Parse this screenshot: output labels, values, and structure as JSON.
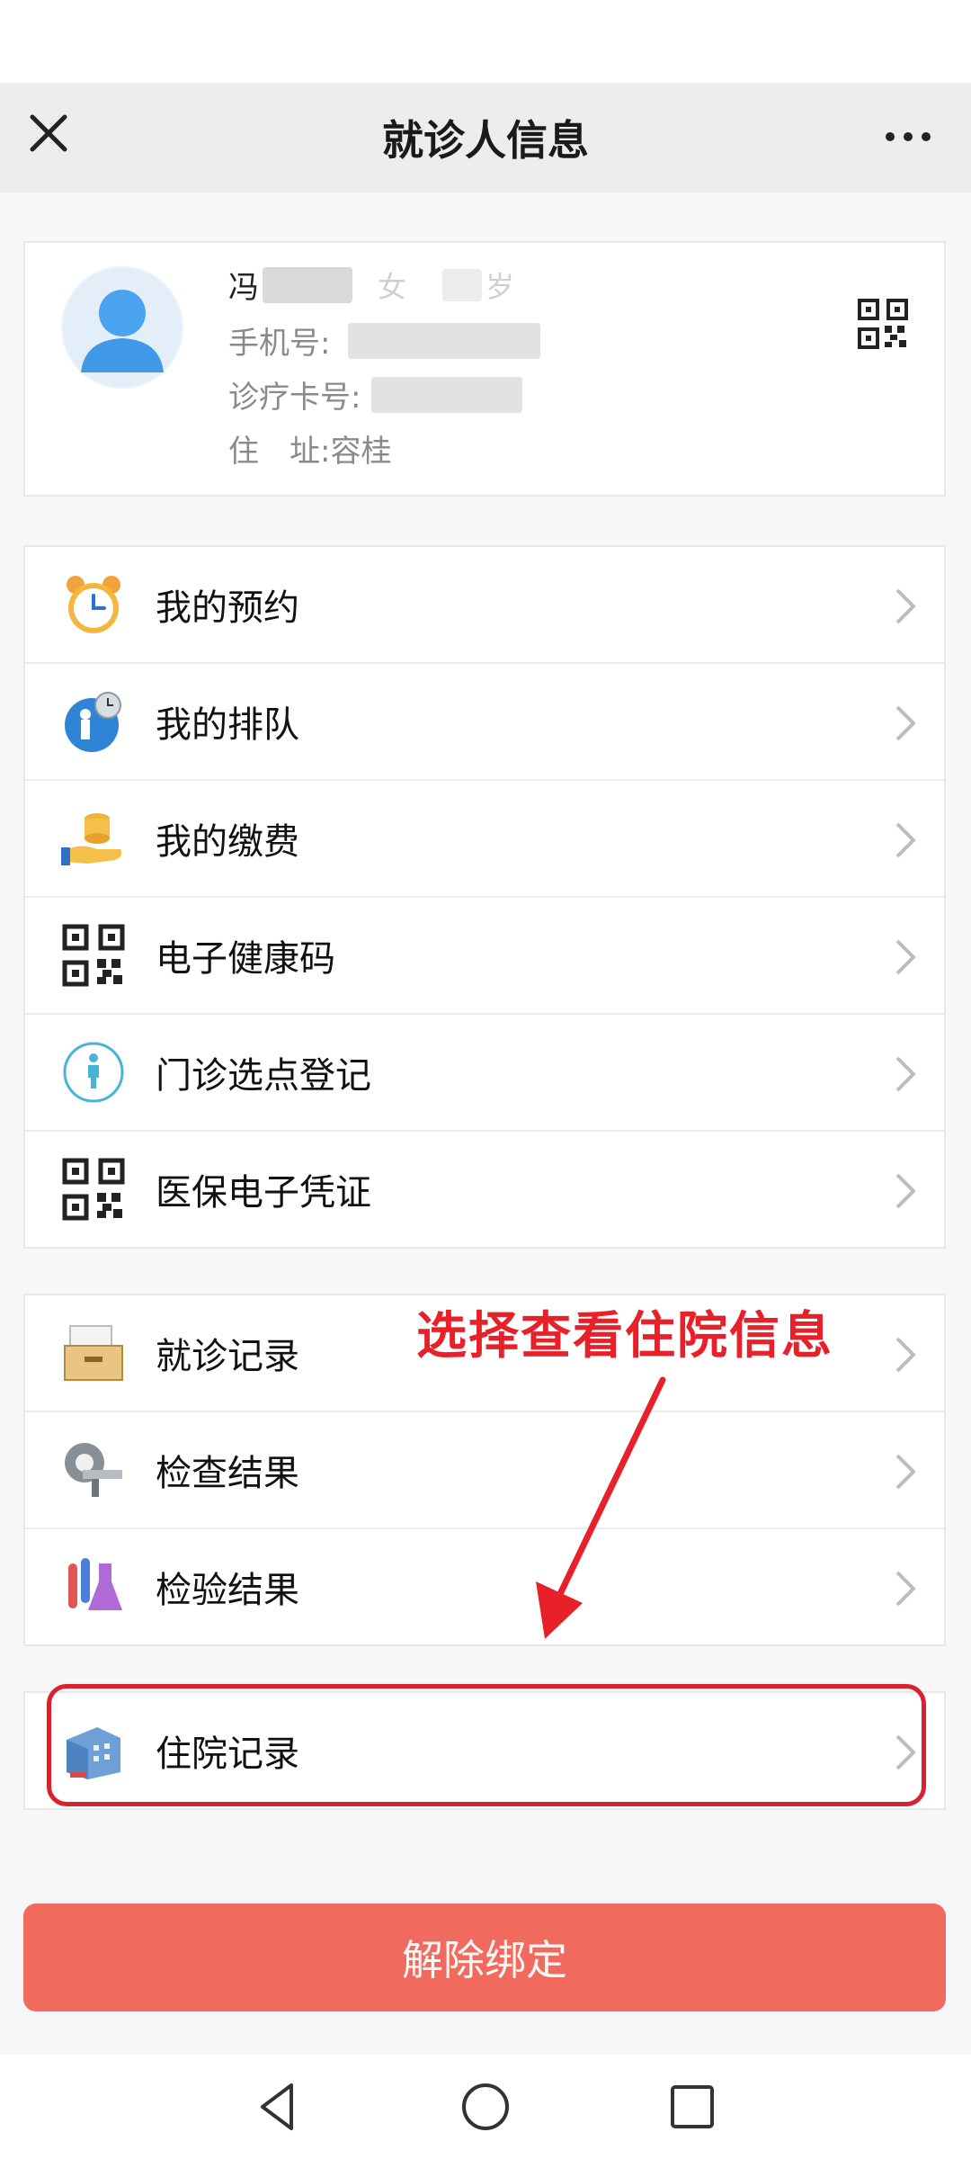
{
  "header": {
    "title": "就诊人信息",
    "close_icon": "close-icon",
    "more_icon": "more-icon"
  },
  "patient": {
    "name_visible": "冯",
    "gender": "女",
    "age_suffix": "岁",
    "phone_label": "手机号:",
    "card_label": "诊疗卡号:",
    "address_label": "住　址:",
    "address_value": "容桂"
  },
  "menu_group_1": [
    {
      "label": "我的预约",
      "icon": "alarm-clock-icon"
    },
    {
      "label": "我的排队",
      "icon": "queue-icon"
    },
    {
      "label": "我的缴费",
      "icon": "payment-coins-icon"
    },
    {
      "label": "电子健康码",
      "icon": "qr-code-icon"
    },
    {
      "label": "门诊选点登记",
      "icon": "person-icon"
    },
    {
      "label": "医保电子凭证",
      "icon": "qr-code-icon"
    }
  ],
  "menu_group_2": [
    {
      "label": "就诊记录",
      "icon": "records-drawer-icon"
    },
    {
      "label": "检查结果",
      "icon": "ct-scanner-icon"
    },
    {
      "label": "检验结果",
      "icon": "test-tubes-icon"
    }
  ],
  "menu_group_3": [
    {
      "label": "住院记录",
      "icon": "hospital-building-icon"
    }
  ],
  "annotation": {
    "text": "选择查看住院信息",
    "color": "#e8202a"
  },
  "unbind_button": {
    "label": "解除绑定",
    "color": "#f06a5e"
  },
  "navbar": {
    "back_icon": "back-triangle-icon",
    "home_icon": "home-circle-icon",
    "recents_icon": "recents-square-icon"
  }
}
